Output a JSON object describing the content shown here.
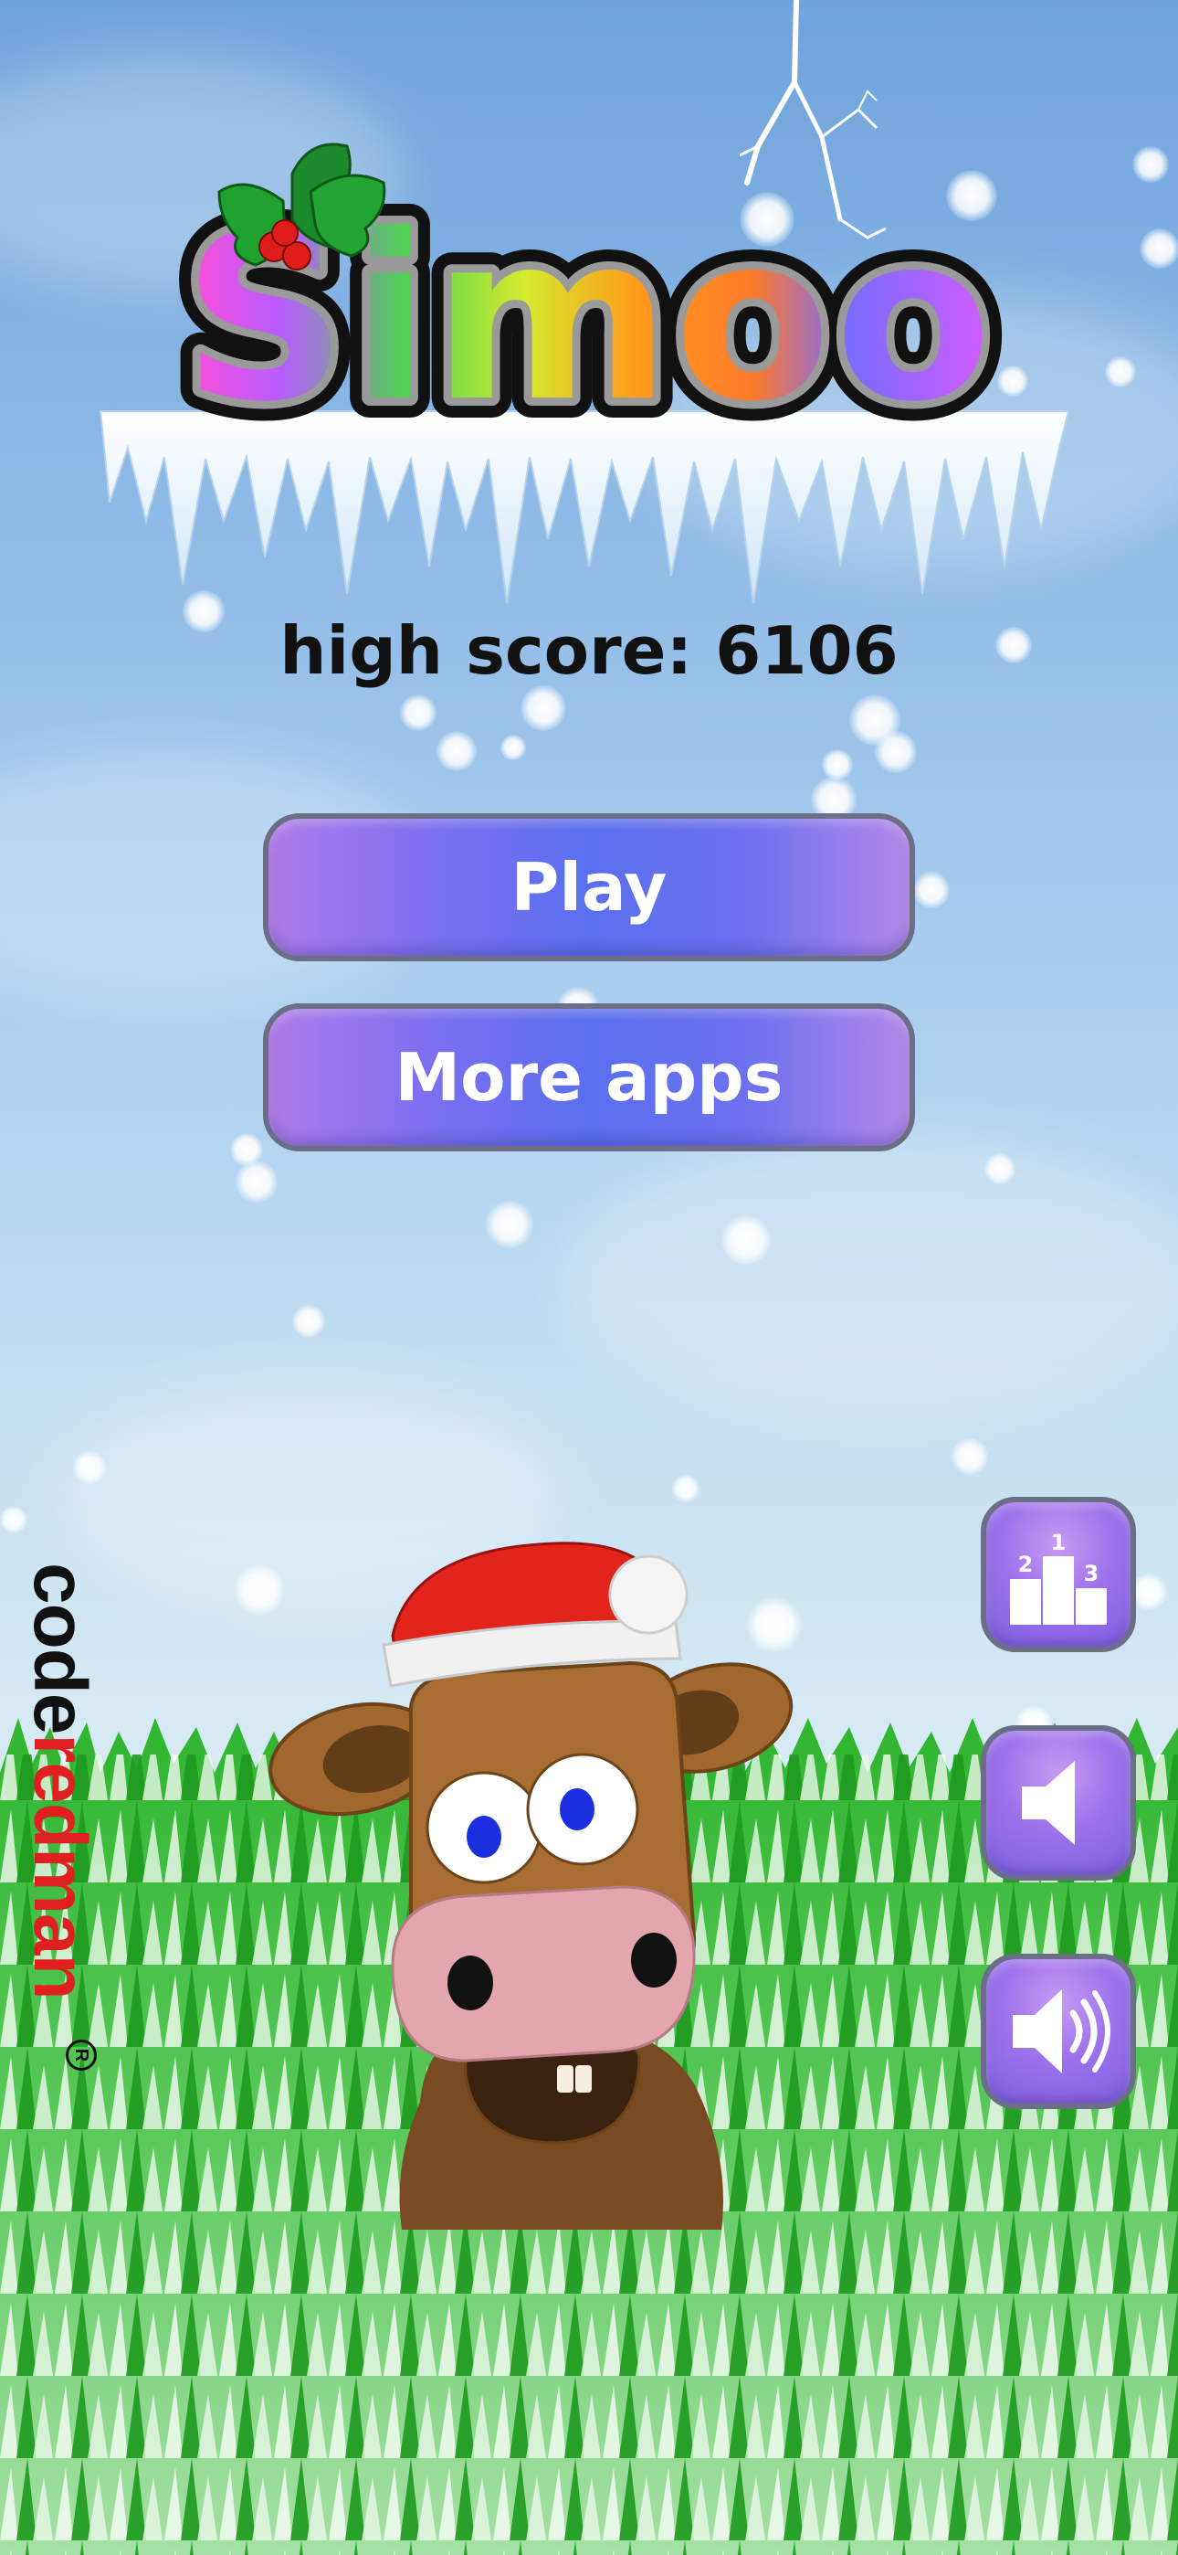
{
  "game": {
    "title": "Simoo",
    "high_score_label": "high score: 6106"
  },
  "menu": {
    "play_label": "Play",
    "more_apps_label": "More apps"
  },
  "side_buttons": {
    "leaderboard_icon": "leaderboard-podium-icon",
    "mute_icon": "speaker-muted-icon",
    "sound_icon": "speaker-on-icon"
  },
  "brand": {
    "part1": "code",
    "part2": "redman",
    "registered": "R"
  },
  "colors": {
    "button_purple": "#7c6ff0",
    "button_border": "#6b6e86",
    "brand_red": "#e02020",
    "sky_top": "#6fa3db",
    "grass_green": "#2fb52f"
  }
}
